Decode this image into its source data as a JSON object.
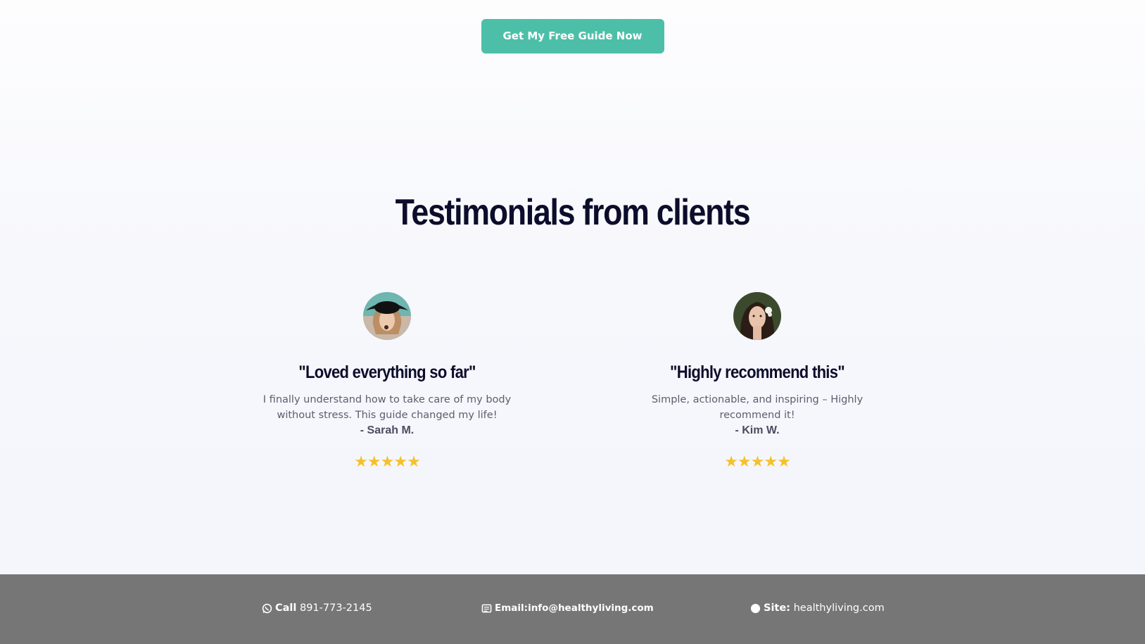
{
  "cta": {
    "label": "Get My Free Guide Now",
    "color": "#4dbfa9"
  },
  "testimonials": {
    "title": "Testimonials from clients",
    "items": [
      {
        "title": "\"Loved everything so far\"",
        "text": "I finally understand how to take care of my body without stress. This guide changed my life!",
        "author": "- Sarah M.",
        "stars": "★★★★★",
        "rating": 5
      },
      {
        "title": "\"Highly recommend this\"",
        "text": "Simple, actionable, and inspiring – Highly recommend it!",
        "author": "- Kim W.",
        "stars": "★★★★★",
        "rating": 5
      }
    ]
  },
  "footer": {
    "call_label": "Call",
    "call_value": "891-773-2145",
    "email_label": "Email:",
    "email_value": "info@healthyliving.com",
    "site_label": "Site:",
    "site_value": "healthyliving.com",
    "icons": [
      "whatsapp-icon",
      "envelope-icon",
      "globe-icon"
    ],
    "background": "#767676"
  },
  "colors": {
    "star": "#f4c12c",
    "heading": "#0c0d2b"
  }
}
